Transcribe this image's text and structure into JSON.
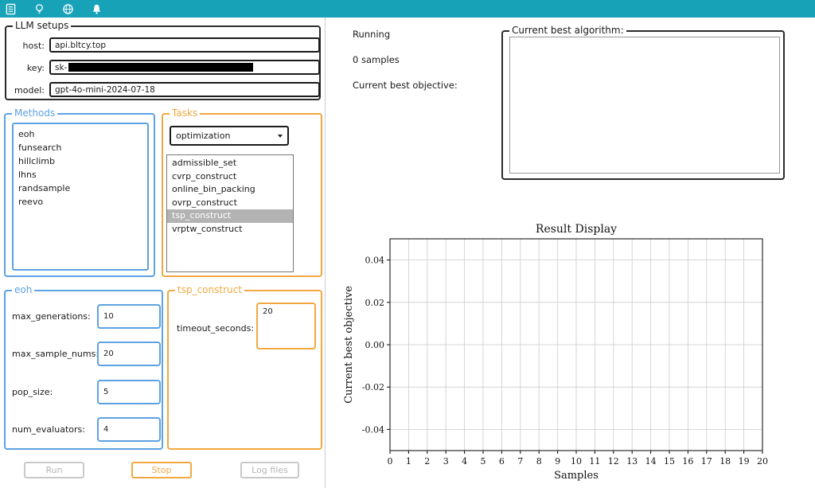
{
  "colors": {
    "toolbar": "#17a2b8",
    "accent_blue": "#5da2e2",
    "accent_orange": "#f2a840",
    "selected_bg": "#b3b3b3"
  },
  "toolbar": {
    "icons": [
      "document-icon",
      "lightbulb-icon",
      "globe-icon",
      "bell-icon"
    ]
  },
  "llm_setups": {
    "title": "LLM setups",
    "host_label": "host:",
    "host_value": "api.bltcy.top",
    "key_label": "key:",
    "key_value": "sk-",
    "model_label": "model:",
    "model_value": "gpt-4o-mini-2024-07-18"
  },
  "methods": {
    "title": "Methods",
    "items": [
      "eoh",
      "funsearch",
      "hillclimb",
      "lhns",
      "randsample",
      "reevo"
    ]
  },
  "tasks": {
    "title": "Tasks",
    "dropdown_value": "optimization",
    "items": [
      "admissible_set",
      "cvrp_construct",
      "online_bin_packing",
      "ovrp_construct",
      "tsp_construct",
      "vrptw_construct"
    ],
    "selected_item": "tsp_construct"
  },
  "eoh_params": {
    "title": "eoh",
    "fields": [
      {
        "label": "max_generations:",
        "value": "10"
      },
      {
        "label": "max_sample_nums:",
        "value": "20"
      },
      {
        "label": "pop_size:",
        "value": "5"
      },
      {
        "label": "num_evaluators:",
        "value": "4"
      }
    ]
  },
  "task_params": {
    "title": "tsp_construct",
    "fields": [
      {
        "label": "timeout_seconds:",
        "value": "20"
      }
    ]
  },
  "actions": {
    "run": "Run",
    "stop": "Stop",
    "log_files": "Log files"
  },
  "status": {
    "state": "Running",
    "samples": "0 samples",
    "objective_label": "Current best objective:",
    "objective_value": ""
  },
  "algorithm_panel": {
    "title": "Current best algorithm:",
    "content": ""
  },
  "chart_data": {
    "type": "line",
    "title": "Result Display",
    "xlabel": "Samples",
    "ylabel": "Current best objective",
    "xlim": [
      0,
      20
    ],
    "ylim": [
      -0.05,
      0.05
    ],
    "x_ticks": [
      0,
      1,
      2,
      3,
      4,
      5,
      6,
      7,
      8,
      9,
      10,
      11,
      12,
      13,
      14,
      15,
      16,
      17,
      18,
      19,
      20
    ],
    "y_ticks": [
      -0.04,
      -0.02,
      0.0,
      0.02,
      0.04
    ],
    "grid": true,
    "legend": false,
    "series": []
  }
}
